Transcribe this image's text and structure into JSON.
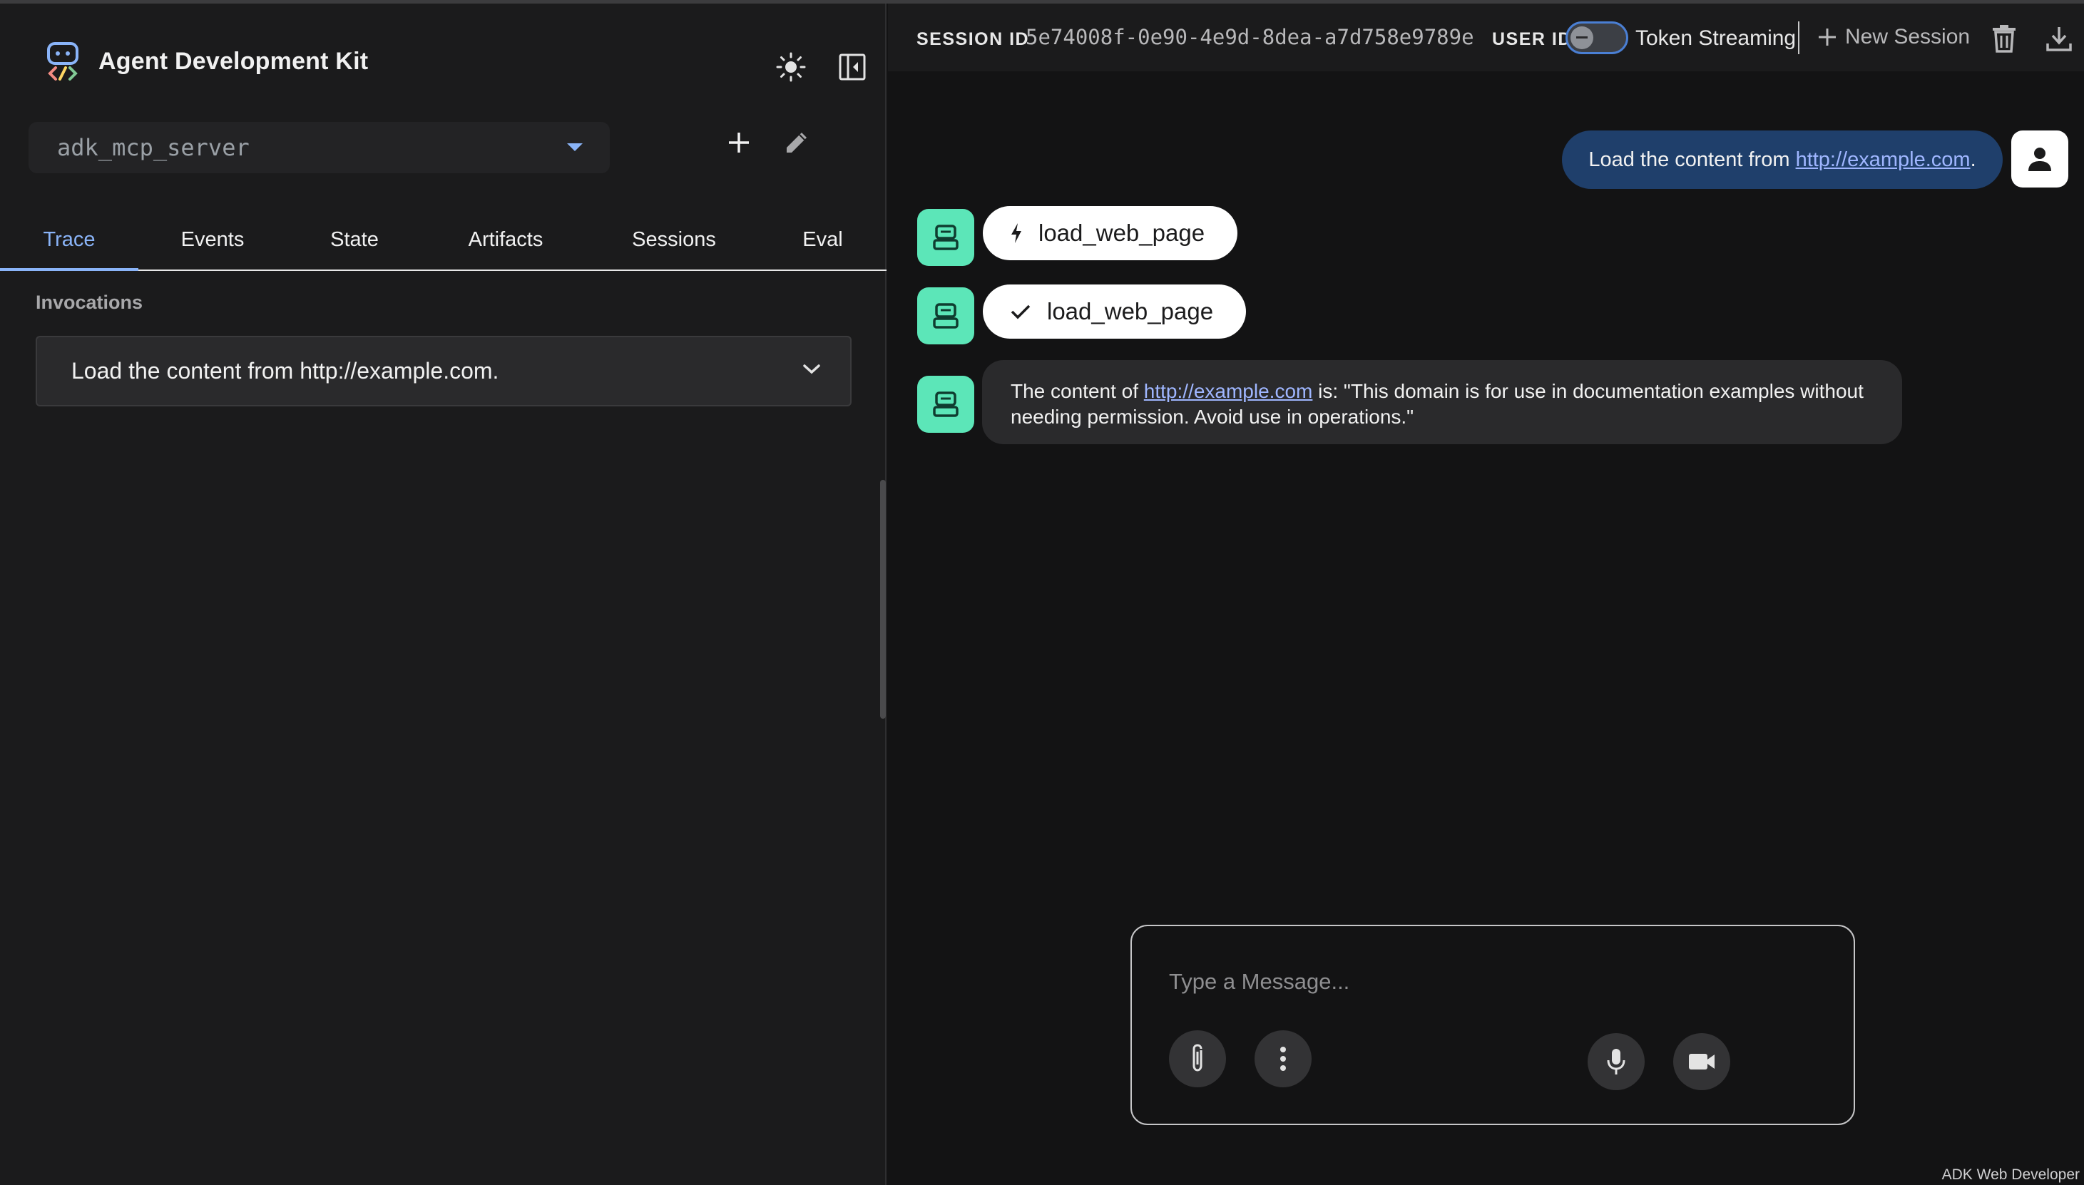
{
  "app": {
    "title": "Agent Development Kit"
  },
  "sidebar": {
    "selected_app": "adk_mcp_server",
    "tabs": [
      {
        "label": "Trace",
        "active": true
      },
      {
        "label": "Events",
        "active": false
      },
      {
        "label": "State",
        "active": false
      },
      {
        "label": "Artifacts",
        "active": false
      },
      {
        "label": "Sessions",
        "active": false
      },
      {
        "label": "Eval",
        "active": false
      }
    ],
    "section_label": "Invocations",
    "invocations": [
      {
        "label": "Load the content from http://example.com."
      }
    ]
  },
  "topbar": {
    "session_id_label": "SESSION ID",
    "session_id": "5e74008f-0e90-4e9d-8dea-a7d758e9789e",
    "user_id_label": "USER ID",
    "token_streaming_label": "Token Streaming",
    "token_streaming_on": false,
    "new_session_label": "New Session"
  },
  "chat": {
    "user_message": {
      "prefix": "Load the content from ",
      "link": "http://example.com",
      "suffix": "."
    },
    "function_call": {
      "name": "load_web_page",
      "icon": "bolt-icon"
    },
    "function_response": {
      "name": "load_web_page",
      "icon": "check-icon"
    },
    "bot_message": {
      "prefix": "The content of ",
      "link": "http://example.com",
      "suffix": " is: \"This domain is for use in documentation examples without needing permission. Avoid use in operations.\""
    }
  },
  "composer": {
    "placeholder": "Type a Message..."
  },
  "footer": {
    "note": "ADK Web Developer"
  },
  "colors": {
    "background": "#131314",
    "sidebar": "#1b1b1c",
    "accent": "#8ab4f8",
    "user_bubble": "#1f3f6b",
    "bot_avatar": "#5ce6b8",
    "link": "#9fb6ff"
  }
}
